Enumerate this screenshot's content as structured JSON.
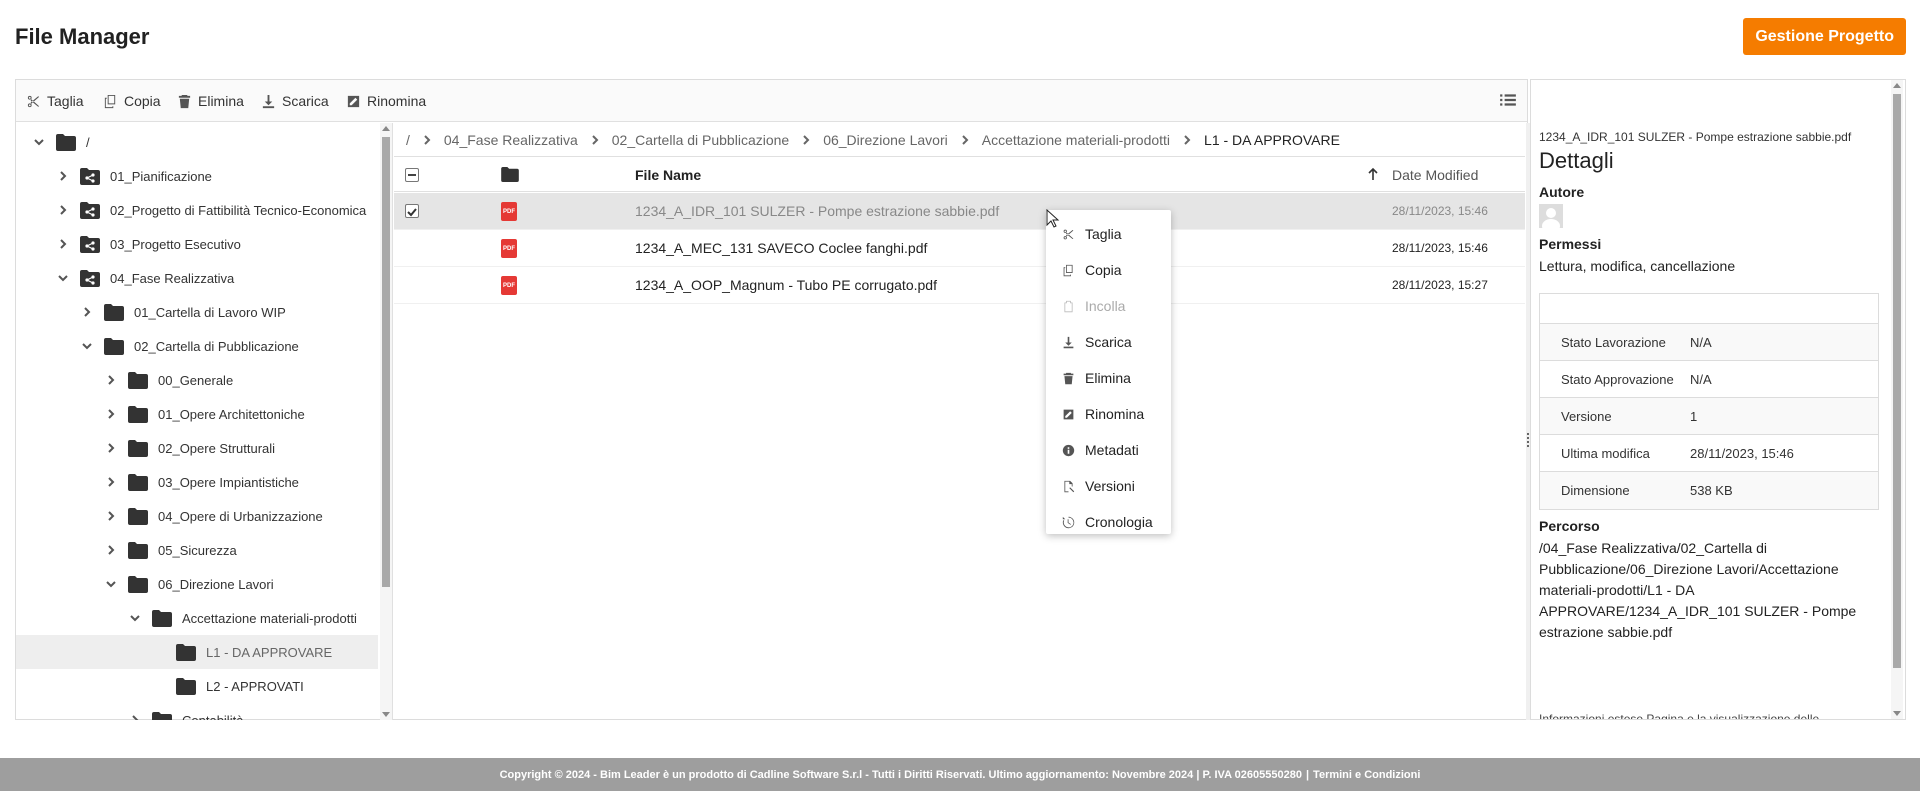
{
  "app": {
    "title": "File Manager",
    "primary_button": "Gestione Progetto"
  },
  "toolbar": {
    "items": [
      {
        "label": "Taglia",
        "icon": "scissors-icon"
      },
      {
        "label": "Copia",
        "icon": "copy-icon"
      },
      {
        "label": "Elimina",
        "icon": "trash-icon"
      },
      {
        "label": "Scarica",
        "icon": "download-icon"
      },
      {
        "label": "Rinomina",
        "icon": "rename-icon"
      }
    ],
    "view_toggle_icon": "list-view-icon"
  },
  "tree": {
    "rows": [
      {
        "label": "/",
        "expanded": true,
        "shared": false
      },
      {
        "label": "01_Pianificazione",
        "expanded": false,
        "shared": true
      },
      {
        "label": "02_Progetto di Fattibilità Tecnico-Economica",
        "expanded": false,
        "shared": true
      },
      {
        "label": "03_Progetto Esecutivo",
        "expanded": false,
        "shared": true
      },
      {
        "label": "04_Fase Realizzativa",
        "expanded": true,
        "shared": true
      },
      {
        "label": "01_Cartella di Lavoro WIP",
        "expanded": false,
        "shared": false
      },
      {
        "label": "02_Cartella di Pubblicazione",
        "expanded": true,
        "shared": false
      },
      {
        "label": "00_Generale",
        "expanded": false,
        "shared": false
      },
      {
        "label": "01_Opere Architettoniche",
        "expanded": false,
        "shared": false
      },
      {
        "label": "02_Opere Strutturali",
        "expanded": false,
        "shared": false
      },
      {
        "label": "03_Opere Impiantistiche",
        "expanded": false,
        "shared": false
      },
      {
        "label": "04_Opere di Urbanizzazione",
        "expanded": false,
        "shared": false
      },
      {
        "label": "05_Sicurezza",
        "expanded": false,
        "shared": false
      },
      {
        "label": "06_Direzione Lavori",
        "expanded": true,
        "shared": false
      },
      {
        "label": "Accettazione materiali-prodotti",
        "expanded": true,
        "shared": false
      },
      {
        "label": "L1 - DA APPROVARE",
        "expanded": null,
        "shared": false,
        "selected": true
      },
      {
        "label": "L2 - APPROVATI",
        "expanded": null,
        "shared": false
      },
      {
        "label": "Contabilità",
        "expanded": false,
        "shared": false
      }
    ]
  },
  "breadcrumb": {
    "root": "/",
    "items": [
      "04_Fase Realizzativa",
      "02_Cartella di Pubblicazione",
      "06_Direzione Lavori",
      "Accettazione materiali-prodotti",
      "L1 - DA APPROVARE"
    ]
  },
  "grid": {
    "columns": {
      "name": "File Name",
      "date": "Date Modified"
    },
    "rows": [
      {
        "name": "1234_A_IDR_101 SULZER - Pompe estrazione sabbie.pdf",
        "date": "28/11/2023, 15:46",
        "selected": true
      },
      {
        "name": "1234_A_MEC_131 SAVECO Coclee fanghi.pdf",
        "date": "28/11/2023, 15:46",
        "selected": false
      },
      {
        "name": "1234_A_OOP_Magnum - Tubo PE corrugato.pdf",
        "date": "28/11/2023, 15:27",
        "selected": false
      }
    ],
    "file_badge": "PDF"
  },
  "context_menu": {
    "items": [
      {
        "label": "Taglia",
        "icon": "scissors-icon",
        "disabled": false
      },
      {
        "label": "Copia",
        "icon": "copy-icon",
        "disabled": false
      },
      {
        "label": "Incolla",
        "icon": "paste-icon",
        "disabled": true
      },
      {
        "label": "Scarica",
        "icon": "download-icon",
        "disabled": false
      },
      {
        "label": "Elimina",
        "icon": "trash-icon",
        "disabled": false
      },
      {
        "label": "Rinomina",
        "icon": "rename-icon",
        "disabled": false
      },
      {
        "label": "Metadati",
        "icon": "info-icon",
        "disabled": false
      },
      {
        "label": "Versioni",
        "icon": "versions-icon",
        "disabled": false
      },
      {
        "label": "Cronologia",
        "icon": "history-icon",
        "disabled": false
      }
    ]
  },
  "details": {
    "file_name": "1234_A_IDR_101 SULZER - Pompe estrazione sabbie.pdf",
    "title": "Dettagli",
    "author_label": "Autore",
    "permissions_label": "Permessi",
    "permissions_value": "Lettura, modifica, cancellazione",
    "meta": [
      {
        "key": "Stato Lavorazione",
        "value": "N/A"
      },
      {
        "key": "Stato Approvazione",
        "value": "N/A"
      },
      {
        "key": "Versione",
        "value": "1"
      },
      {
        "key": "Ultima modifica",
        "value": "28/11/2023, 15:46"
      },
      {
        "key": "Dimensione",
        "value": "538 KB"
      }
    ],
    "path_label": "Percorso",
    "path_value": "/04_Fase Realizzativa/02_Cartella di Pubblicazione/06_Direzione Lavori/Accettazione materiali-prodotti/L1 - DA APPROVARE/1234_A_IDR_101 SULZER - Pompe estrazione sabbie.pdf",
    "cut_text": "Informazioni estese Pagina e la visualizzazione delle"
  },
  "footer": {
    "text": "Copyright © 2024 - Bim Leader è un prodotto di Cadline Software S.r.l - Tutti i Diritti Riservati. Ultimo aggiornamento: Novembre 2024 | P. IVA 02605550280",
    "link": "Termini e Condizioni",
    "separator": "|"
  },
  "colors": {
    "accent": "#f57c00",
    "pdf": "#e53935",
    "footer": "#9e9e9e"
  }
}
